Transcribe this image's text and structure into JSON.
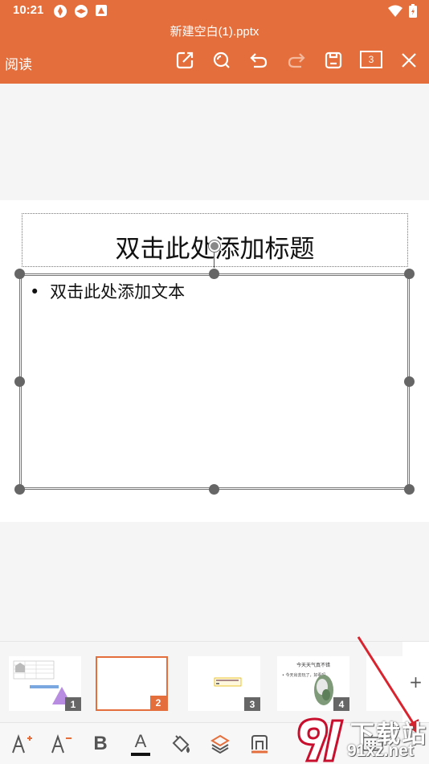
{
  "status": {
    "time": "10:21"
  },
  "header": {
    "filename": "新建空白(1).pptx",
    "read_mode": "阅读",
    "page_count": "3"
  },
  "slide": {
    "title_placeholder": "双击此处添加标题",
    "body_placeholder": "双击此处添加文本",
    "bullet": "•"
  },
  "thumbnails": [
    {
      "number": "1"
    },
    {
      "number": "2",
      "active": true
    },
    {
      "number": "3"
    },
    {
      "number": "4",
      "title": "今天天气真不错",
      "bullet": "• 今天出去玩了，好看吗"
    }
  ],
  "add_slide_label": "+",
  "bottom_toolbar": {
    "bold_label": "B",
    "font_color_label": "A"
  },
  "watermark": {
    "top": "下载站",
    "bottom": "91xz.net"
  },
  "colors": {
    "accent": "#e56f3c"
  }
}
